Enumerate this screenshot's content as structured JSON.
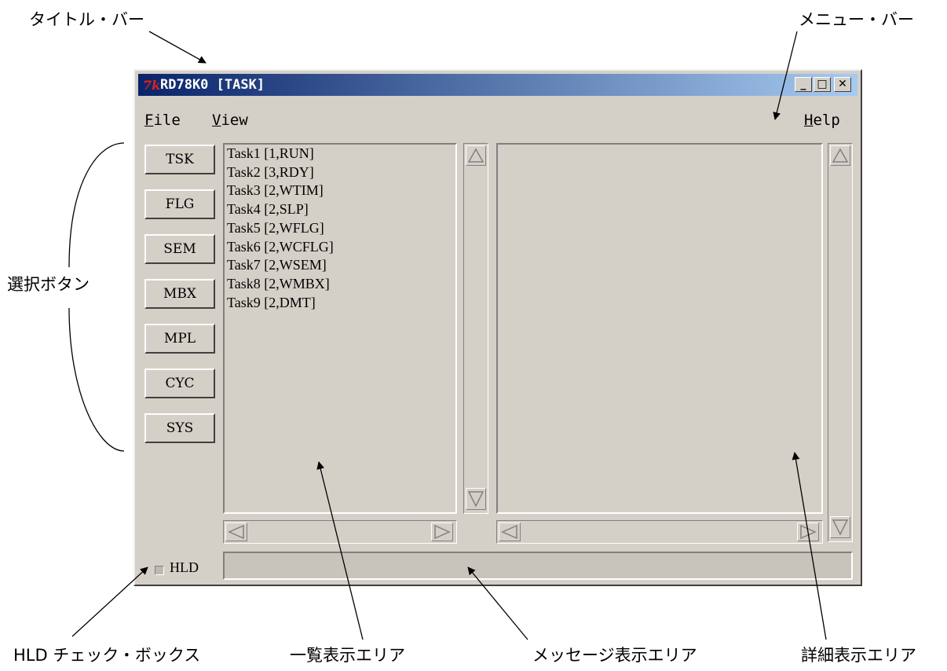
{
  "callouts": {
    "title_bar": "タイトル・バー",
    "menu_bar": "メニュー・バー",
    "select_buttons": "選択ボタン",
    "hld_checkbox": "HLD チェック・ボックス",
    "list_area": "一覧表示エリア",
    "message_area": "メッセージ表示エリア",
    "detail_area": "詳細表示エリア"
  },
  "window": {
    "icon_glyph": "7k",
    "title": "RD78K0 [TASK]",
    "controls": {
      "minimize": "_",
      "maximize": "□",
      "close": "✕"
    }
  },
  "menu": {
    "file": {
      "accel": "F",
      "rest": "ile"
    },
    "view": {
      "accel": "V",
      "rest": "iew"
    },
    "help": {
      "accel": "H",
      "rest": "elp"
    }
  },
  "buttons": [
    "TSK",
    "FLG",
    "SEM",
    "MBX",
    "MPL",
    "CYC",
    "SYS"
  ],
  "task_list": [
    "Task1 [1,RUN]",
    "Task2 [3,RDY]",
    "Task3 [2,WTIM]",
    "Task4 [2,SLP]",
    "Task5 [2,WFLG]",
    "Task6 [2,WCFLG]",
    "Task7 [2,WSEM]",
    "Task8 [2,WMBX]",
    "Task9 [2,DMT]"
  ],
  "hld": {
    "label": "HLD",
    "checked": false
  },
  "message": ""
}
